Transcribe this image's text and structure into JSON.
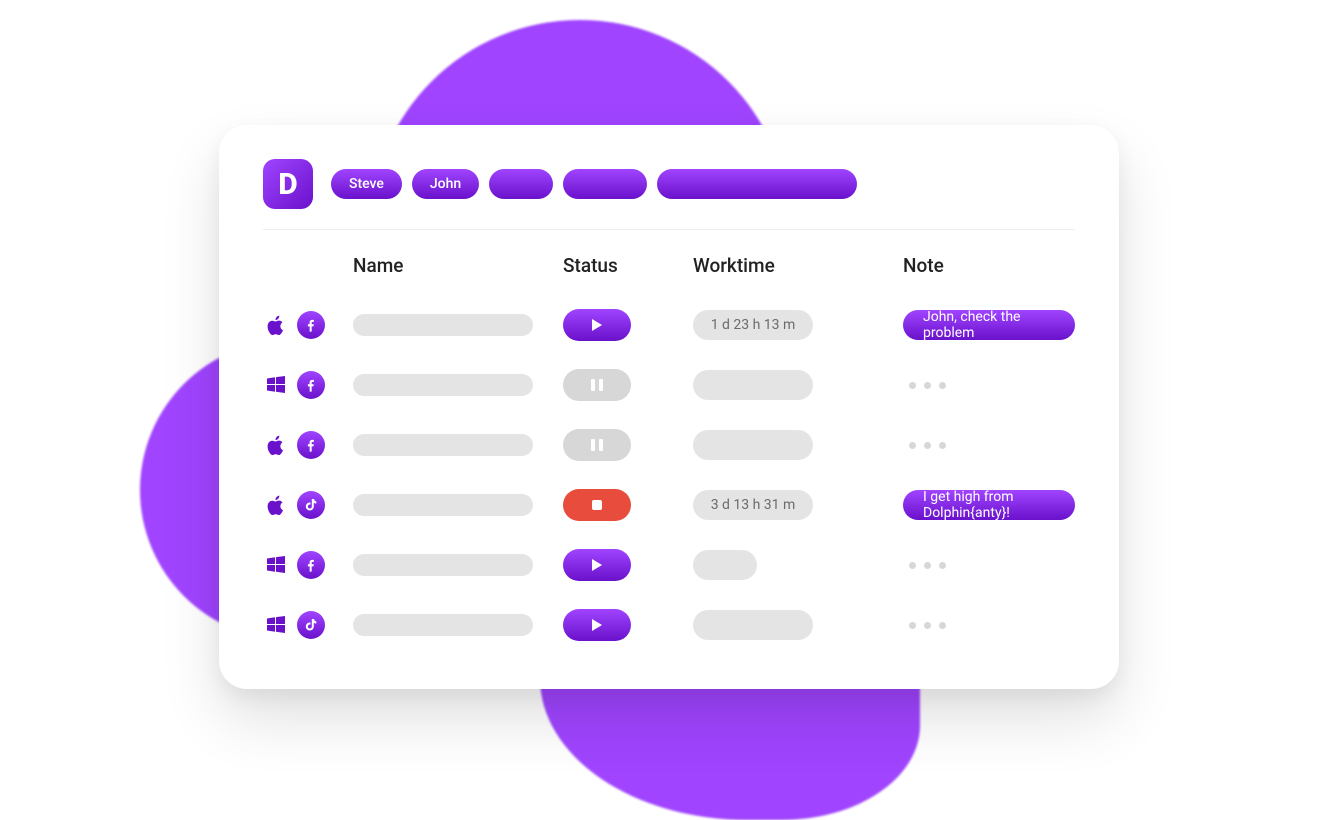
{
  "app": {
    "logo_letter": "D"
  },
  "chips": [
    {
      "label": "Steve",
      "style": "text"
    },
    {
      "label": "John",
      "style": "text"
    },
    {
      "label": "",
      "style": "empty-sm"
    },
    {
      "label": "",
      "style": "empty-md"
    },
    {
      "label": "",
      "style": "empty-lg"
    }
  ],
  "columns": {
    "name": "Name",
    "status": "Status",
    "worktime": "Worktime",
    "note": "Note"
  },
  "rows": [
    {
      "os": "apple",
      "app": "facebook",
      "status": "play",
      "worktime": "1 d 23 h 13 m",
      "note": "John, check the problem",
      "note_type": "pill"
    },
    {
      "os": "windows",
      "app": "facebook",
      "status": "pause",
      "worktime": "",
      "note": "",
      "note_type": "dots"
    },
    {
      "os": "apple",
      "app": "facebook",
      "status": "pause",
      "worktime": "",
      "note": "",
      "note_type": "dots"
    },
    {
      "os": "apple",
      "app": "tiktok",
      "status": "stop",
      "worktime": "3 d 13 h 31 m",
      "note": "I get high from Dolphin{anty}!",
      "note_type": "pill"
    },
    {
      "os": "windows",
      "app": "facebook",
      "status": "play",
      "worktime": "",
      "note": "",
      "note_type": "dots",
      "wt_short": true
    },
    {
      "os": "windows",
      "app": "tiktok",
      "status": "play",
      "worktime": "",
      "note": "",
      "note_type": "dots"
    }
  ]
}
